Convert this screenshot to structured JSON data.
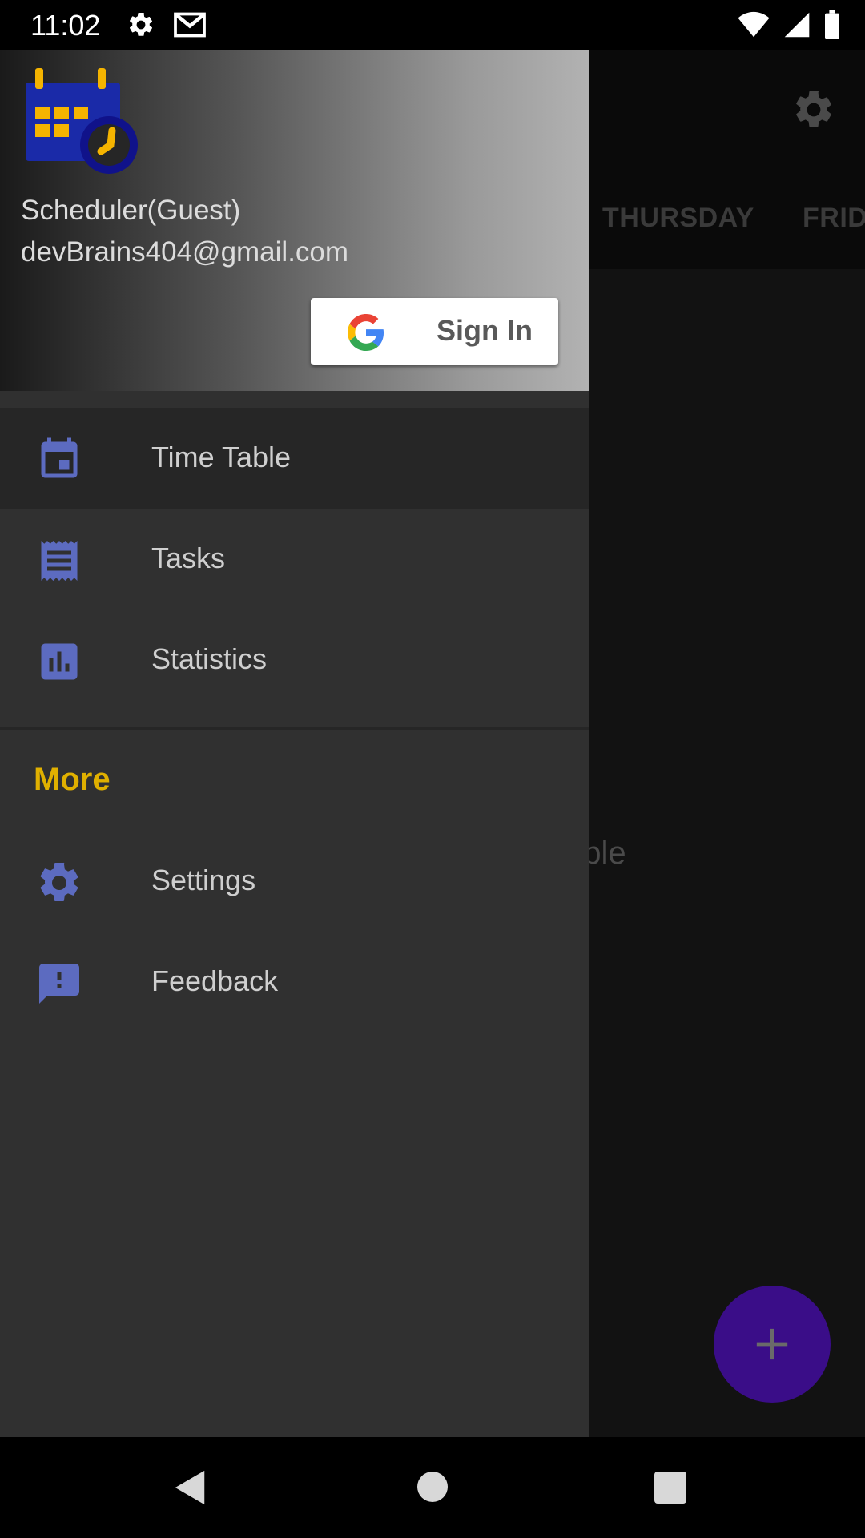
{
  "status_bar": {
    "time": "11:02",
    "icons_left": [
      "settings-icon",
      "gmail-icon"
    ],
    "icons_right": [
      "wifi-icon",
      "signal-icon",
      "battery-icon"
    ]
  },
  "app": {
    "tabs": [
      "THURSDAY",
      "FRID"
    ],
    "empty_text": "able",
    "fab_label": "+"
  },
  "drawer": {
    "user_name": "Scheduler(Guest)",
    "user_email": "devBrains404@gmail.com",
    "signin_label": "Sign In",
    "items": [
      {
        "label": "Time Table",
        "icon": "calendar-icon",
        "active": true
      },
      {
        "label": "Tasks",
        "icon": "tasks-icon",
        "active": false
      },
      {
        "label": "Statistics",
        "icon": "statistics-icon",
        "active": false
      }
    ],
    "section_title": "More",
    "more_items": [
      {
        "label": "Settings",
        "icon": "settings-icon"
      },
      {
        "label": "Feedback",
        "icon": "feedback-icon"
      }
    ]
  },
  "colors": {
    "accent_icon": "#5c6bc0",
    "section_title": "#e0b000",
    "fab": "#3a0d88"
  }
}
